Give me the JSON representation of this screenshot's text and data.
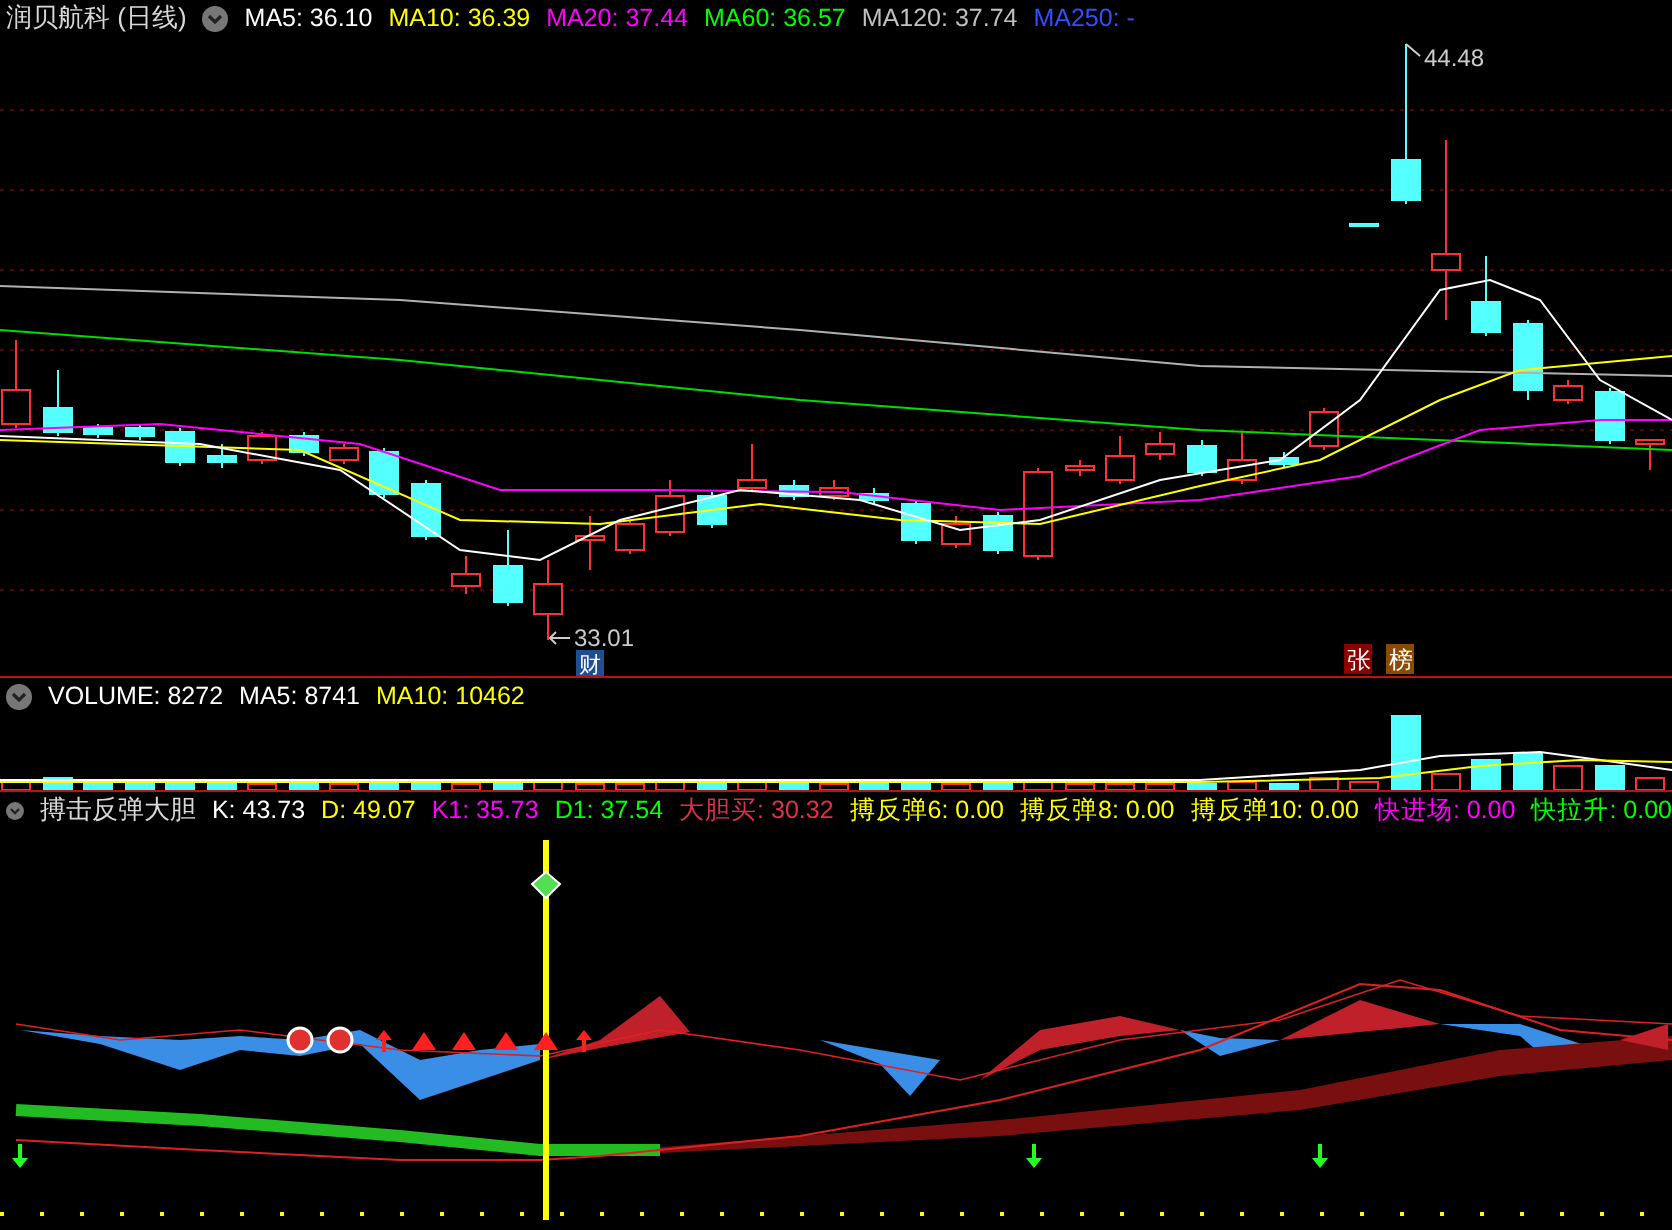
{
  "main_chart": {
    "title": "润贝航科 (日线)",
    "legend": [
      {
        "text": "MA5: 36.10",
        "color": "#ffffff"
      },
      {
        "text": "MA10: 36.39",
        "color": "#ffff00"
      },
      {
        "text": "MA20: 37.44",
        "color": "#ff00ff"
      },
      {
        "text": "MA60: 36.57",
        "color": "#00ff00"
      },
      {
        "text": "MA120: 37.74",
        "color": "#c0c0c0"
      },
      {
        "text": "MA250: -",
        "color": "#3050ff"
      }
    ],
    "price_labels": [
      "44.48",
      "33.01"
    ],
    "event_tags": [
      {
        "text": "财",
        "color": "#1f4f8f"
      },
      {
        "text": "张",
        "color": "#8b0000"
      },
      {
        "text": "榜",
        "color": "#8b4a00"
      }
    ]
  },
  "volume_panel": {
    "legend": [
      {
        "text": "VOLUME: 8272",
        "color": "#ffffff"
      },
      {
        "text": "MA5: 8741",
        "color": "#ffffff"
      },
      {
        "text": "MA10: 10462",
        "color": "#ffff00"
      }
    ]
  },
  "indicator_panel": {
    "title": "搏击反弹大胆",
    "legend": [
      {
        "text": "K: 43.73",
        "color": "#ffffff"
      },
      {
        "text": "D: 49.07",
        "color": "#ffff00"
      },
      {
        "text": "K1: 35.73",
        "color": "#ff00ff"
      },
      {
        "text": "D1: 37.54",
        "color": "#00ff00"
      },
      {
        "text": "大胆买: 30.32",
        "color": "#e0304a"
      },
      {
        "text": "搏反弹6: 0.00",
        "color": "#ffff00"
      },
      {
        "text": "搏反弹8: 0.00",
        "color": "#ffff00"
      },
      {
        "text": "搏反弹10: 0.00",
        "color": "#ffff00"
      },
      {
        "text": "快进场: 0.00",
        "color": "#ff00ff"
      },
      {
        "text": "快拉升: 0.00",
        "color": "#00ff00"
      }
    ]
  }
}
